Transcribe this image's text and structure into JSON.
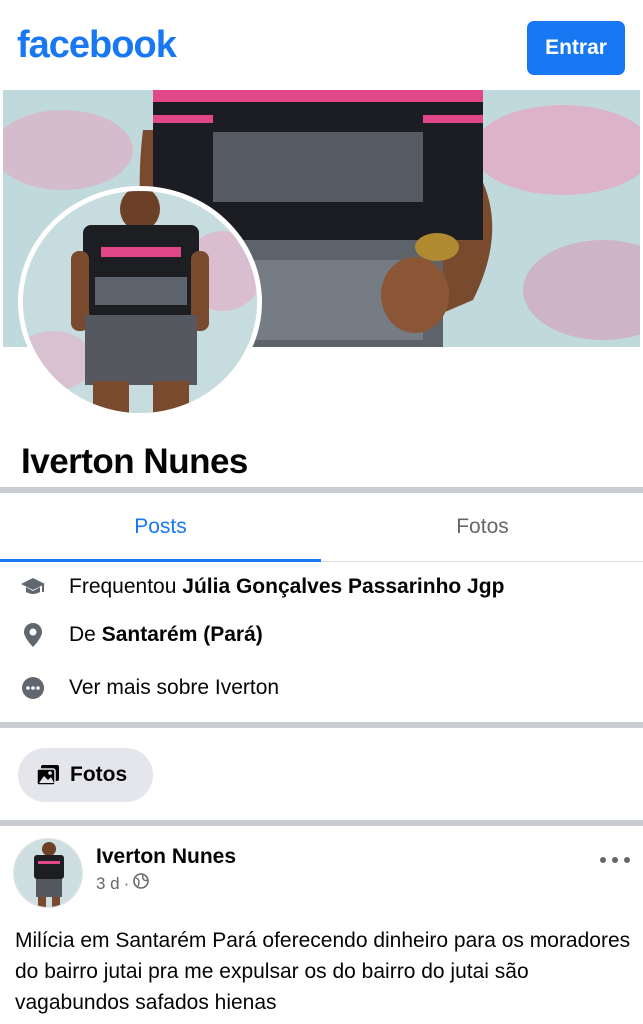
{
  "header": {
    "logo_text": "facebook",
    "login_label": "Entrar",
    "brand_color": "#1877f2"
  },
  "profile": {
    "name": "Iverton Nunes"
  },
  "tabs": [
    {
      "label": "Posts",
      "active": true
    },
    {
      "label": "Fotos",
      "active": false
    }
  ],
  "intro": {
    "studied_prefix": "Frequentou",
    "studied_place": "Júlia Gonçalves Passarinho Jgp",
    "from_prefix": "De",
    "from_place": "Santarém (Pará)",
    "see_more": "Ver mais sobre Iverton"
  },
  "photos_chip": {
    "label": "Fotos",
    "icon": "photos-icon"
  },
  "post": {
    "author": "Iverton Nunes",
    "time": "3 d",
    "separator": "·",
    "privacy_icon": "globe-icon",
    "text": "Milícia em Santarém Pará oferecendo dinheiro para os moradores do bairro jutai pra me expulsar os do bairro do jutai são vagabundos safados hienas"
  },
  "icons": [
    "graduation-cap-icon",
    "location-pin-icon",
    "more-dots-icon",
    "photos-icon",
    "globe-icon",
    "ellipsis-icon"
  ]
}
